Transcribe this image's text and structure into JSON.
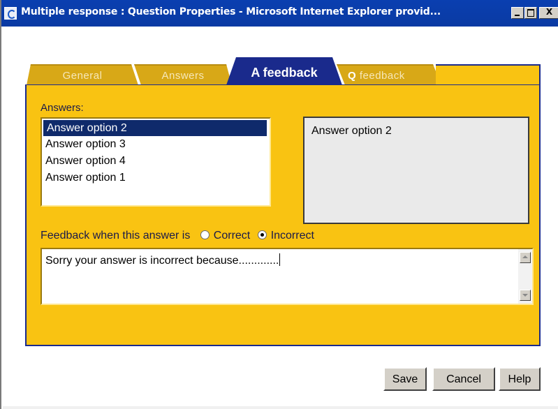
{
  "window": {
    "title": "Multiple response : Question Properties - Microsoft Internet Explorer provid..."
  },
  "tabs": [
    {
      "label": "General",
      "active": false
    },
    {
      "label": "Answers",
      "active": false
    },
    {
      "label": "A feedback",
      "active": true
    },
    {
      "label": "feedback",
      "prefix": "Q",
      "active": false
    }
  ],
  "answers": {
    "label": "Answers:",
    "items": [
      "Answer option 2",
      "Answer option 3",
      "Answer option 4",
      "Answer option 1"
    ],
    "selected": "Answer option 2"
  },
  "preview": {
    "text": "Answer option 2"
  },
  "feedback": {
    "prompt": "Feedback when this answer is",
    "options": [
      {
        "label": "Correct",
        "checked": false
      },
      {
        "label": "Incorrect",
        "checked": true
      }
    ],
    "text": "Sorry your answer is incorrect because............."
  },
  "buttons": {
    "save": "Save",
    "cancel": "Cancel",
    "help": "Help"
  },
  "colors": {
    "panel": "#f9c312",
    "active_tab": "#1a2a8c",
    "inactive_tab": "#d8a817",
    "titlebar": "#0a3fb0",
    "selection": "#0f2a6b"
  }
}
